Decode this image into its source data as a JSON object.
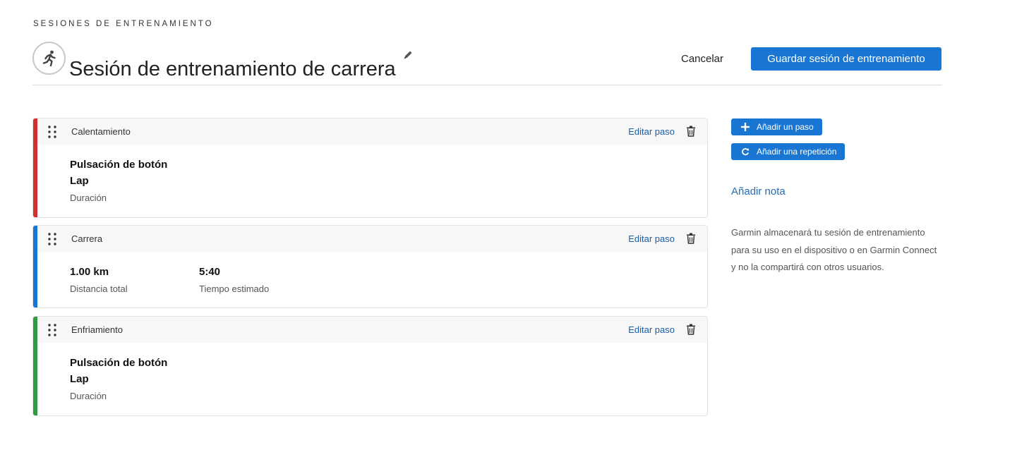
{
  "breadcrumb": "SESIONES DE ENTRENAMIENTO",
  "header": {
    "title": "Sesión de entrenamiento de carrera",
    "sport_icon": "running-person-icon",
    "edit_icon": "pencil-icon",
    "cancel_label": "Cancelar",
    "save_label": "Guardar sesión de entrenamiento"
  },
  "steps": [
    {
      "type": "Calentamiento",
      "color": "#d32f2f",
      "edit_label": "Editar paso",
      "primary": "Pulsación de botón",
      "secondary": "Lap",
      "caption": "Duración"
    },
    {
      "type": "Carrera",
      "color": "#1976d2",
      "edit_label": "Editar paso",
      "distance_value": "1.00 km",
      "distance_label": "Distancia total",
      "time_value": "5:40",
      "time_label": "Tiempo estimado"
    },
    {
      "type": "Enfriamiento",
      "color": "#2e9b44",
      "edit_label": "Editar paso",
      "primary": "Pulsación de botón",
      "secondary": "Lap",
      "caption": "Duración"
    }
  ],
  "sidebar": {
    "add_step_label": "Añadir un paso",
    "add_repeat_label": "Añadir una repetición",
    "add_note_label": "Añadir nota",
    "notice": "Garmin almacenará tu sesión de entrenamiento para su uso en el dispositivo o en Garmin Connect y no la compartirá con otros usuarios."
  },
  "colors": {
    "accent": "#1976d2",
    "link": "#1a5ea8"
  }
}
